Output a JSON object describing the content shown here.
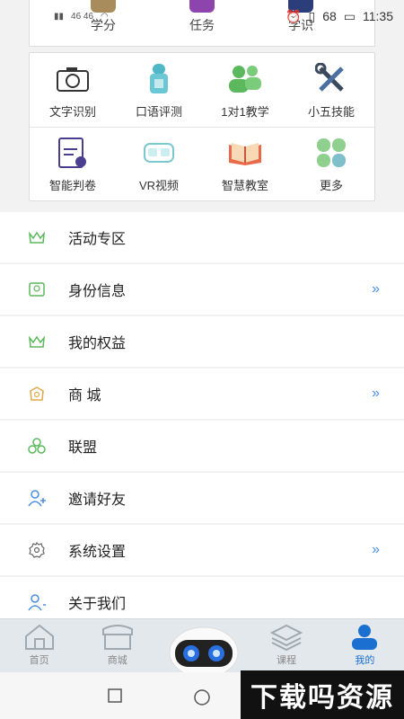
{
  "status": {
    "time": "11:35",
    "battery": "68",
    "net": "46 46"
  },
  "top_tabs": [
    {
      "label": "学分",
      "icon": "coins-icon"
    },
    {
      "label": "任务",
      "icon": "task-icon"
    },
    {
      "label": "学识",
      "icon": "book-icon"
    }
  ],
  "grid": [
    [
      {
        "label": "文字识别",
        "icon": "camera-icon"
      },
      {
        "label": "口语评测",
        "icon": "microphone-robot-icon"
      },
      {
        "label": "1对1教学",
        "icon": "people-icon"
      },
      {
        "label": "小五技能",
        "icon": "tools-icon"
      }
    ],
    [
      {
        "label": "智能判卷",
        "icon": "exam-paper-icon"
      },
      {
        "label": "VR视频",
        "icon": "vr-headset-icon"
      },
      {
        "label": "智慧教室",
        "icon": "open-book-icon"
      },
      {
        "label": "更多",
        "icon": "clover-icon"
      }
    ]
  ],
  "list": [
    {
      "label": "活动专区",
      "icon": "crown-icon",
      "chevron": false
    },
    {
      "label": "身份信息",
      "icon": "id-badge-icon",
      "chevron": true
    },
    {
      "label": "我的权益",
      "icon": "crown-icon",
      "chevron": false
    },
    {
      "label": "商 城",
      "icon": "shop-icon",
      "chevron": true
    },
    {
      "label": "联盟",
      "icon": "circles-icon",
      "chevron": false
    },
    {
      "label": "邀请好友",
      "icon": "add-user-icon",
      "chevron": false
    },
    {
      "label": "系统设置",
      "icon": "gear-icon",
      "chevron": true
    },
    {
      "label": "关于我们",
      "icon": "user-icon",
      "chevron": false
    }
  ],
  "chevron_glyph": "»",
  "bottom_nav": [
    {
      "label": "首页",
      "icon": "home-icon"
    },
    {
      "label": "商城",
      "icon": "store-icon"
    },
    {
      "label": "课程",
      "icon": "layers-icon"
    },
    {
      "label": "我的",
      "icon": "profile-icon"
    }
  ],
  "watermark": "下载吗资源",
  "colors": {
    "accent": "#1a6fd0",
    "chevron": "#4a8ee0",
    "green": "#5cb85c"
  }
}
